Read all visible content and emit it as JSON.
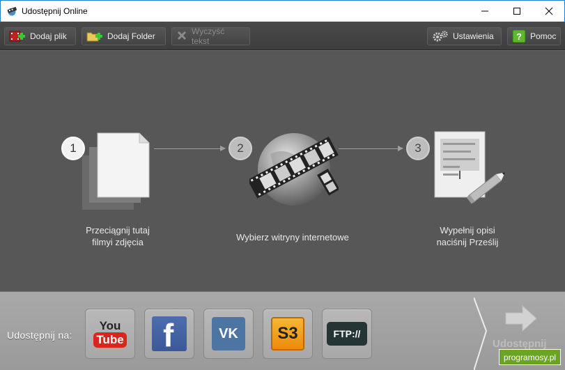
{
  "window": {
    "title": "Udostępnij Online",
    "minimize": "—",
    "maximize": "☐",
    "close": "✕"
  },
  "toolbar": {
    "add_file": "Dodaj plik",
    "add_folder": "Dodaj Folder",
    "clear_text": "Wyczyść tekst",
    "settings": "Ustawienia",
    "help": "Pomoc"
  },
  "steps": [
    {
      "number": "1",
      "label_line1": "Przeciągnij tutaj",
      "label_line2": "filmyi zdjęcia"
    },
    {
      "number": "2",
      "label_line1": "Wybierz witryny internetowe",
      "label_line2": ""
    },
    {
      "number": "3",
      "label_line1": "Wypełnij opisi",
      "label_line2": "naciśnij Prześlij"
    }
  ],
  "share": {
    "label": "Udostępnij na:",
    "services": [
      {
        "name": "YouTube",
        "text1": "You",
        "text2": "Tube"
      },
      {
        "name": "Facebook",
        "text": "f"
      },
      {
        "name": "VK",
        "text": "VK"
      },
      {
        "name": "Amazon S3",
        "text": "S3"
      },
      {
        "name": "FTP",
        "text": "FTP://"
      }
    ],
    "upload": "Udostępnij"
  },
  "watermark": "programosy.pl",
  "colors": {
    "toolbar_bg": "#444444",
    "main_bg": "#575757",
    "bottom_bg": "#a3a3a3",
    "youtube_red": "#d9251d",
    "facebook_blue": "#3b5998",
    "vk_blue": "#4c75a3",
    "s3_orange": "#f39c12",
    "ftp_dark": "#2c3e3e",
    "watermark_green": "#6ba323"
  }
}
